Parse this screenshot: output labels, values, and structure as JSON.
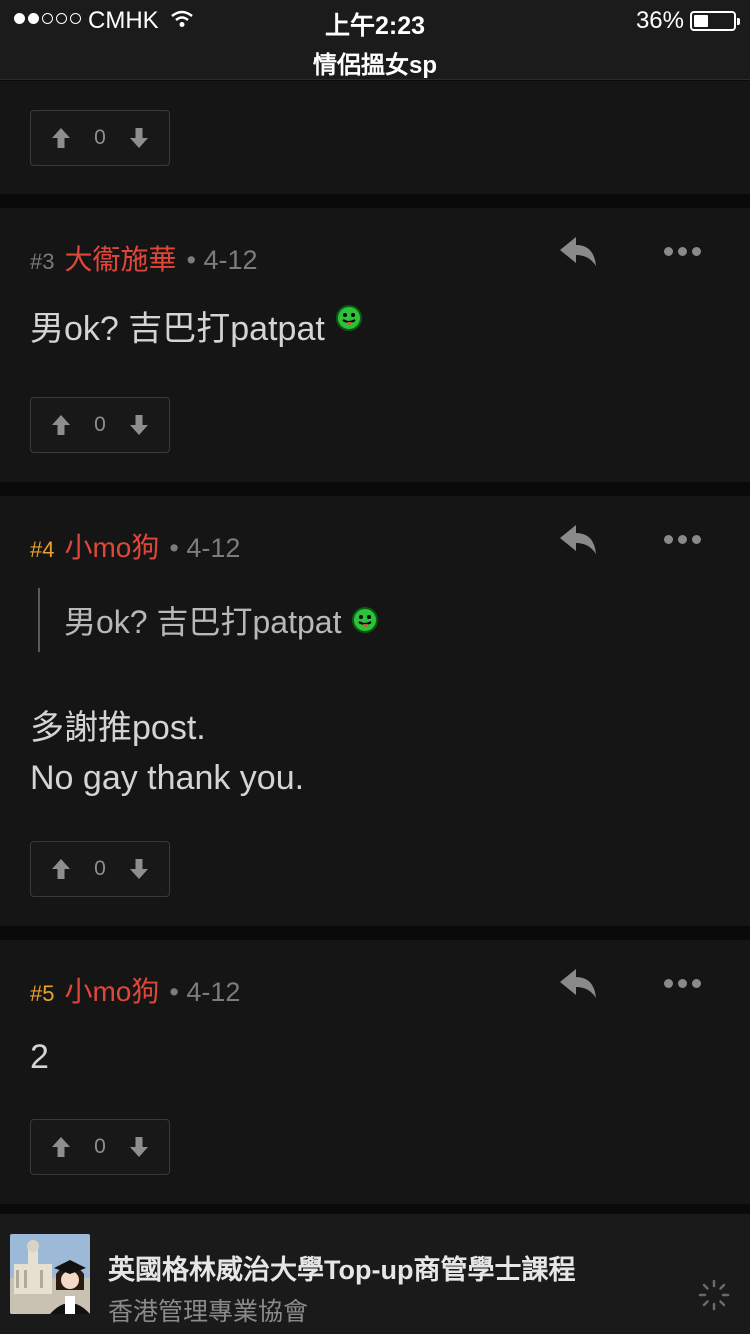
{
  "status_bar": {
    "carrier": "CMHK",
    "time": "上午2:23",
    "battery_percent": "36%",
    "battery_level": 0.36,
    "signal_bars_filled": 2,
    "signal_bars_total": 5
  },
  "header": {
    "title": "情侶搵女sp"
  },
  "posts": [
    {
      "number": "",
      "author": "",
      "date": "",
      "body": [],
      "votes": "0"
    },
    {
      "number": "#3",
      "author": "大衞施華",
      "date": "• 4-12",
      "body": [
        "男ok? 吉巴打patpat"
      ],
      "votes": "0"
    },
    {
      "number": "#4",
      "author": "小mo狗",
      "date": "• 4-12",
      "quote": "男ok? 吉巴打patpat",
      "body": [
        "多謝推post.",
        "No gay thank you."
      ],
      "votes": "0"
    },
    {
      "number": "#5",
      "author": "小mo狗",
      "date": "• 4-12",
      "body": [
        "2"
      ],
      "votes": "0"
    }
  ],
  "colors": {
    "author": "#e0473a",
    "post_number_highlight": "#e8a12a",
    "post_number_default": "#7a7a7a",
    "card_background": "#151515",
    "page_background": "#0a0a0a"
  },
  "icons": {
    "reply": "reply-arrow-icon",
    "more": "ellipsis-icon",
    "upvote": "arrow-up-icon",
    "downvote": "arrow-down-icon",
    "emoji": "tongue-out-emoji-icon"
  },
  "ad": {
    "title": "英國格林威治大學Top-up商管學士課程",
    "subtitle": "香港管理專業協會"
  }
}
